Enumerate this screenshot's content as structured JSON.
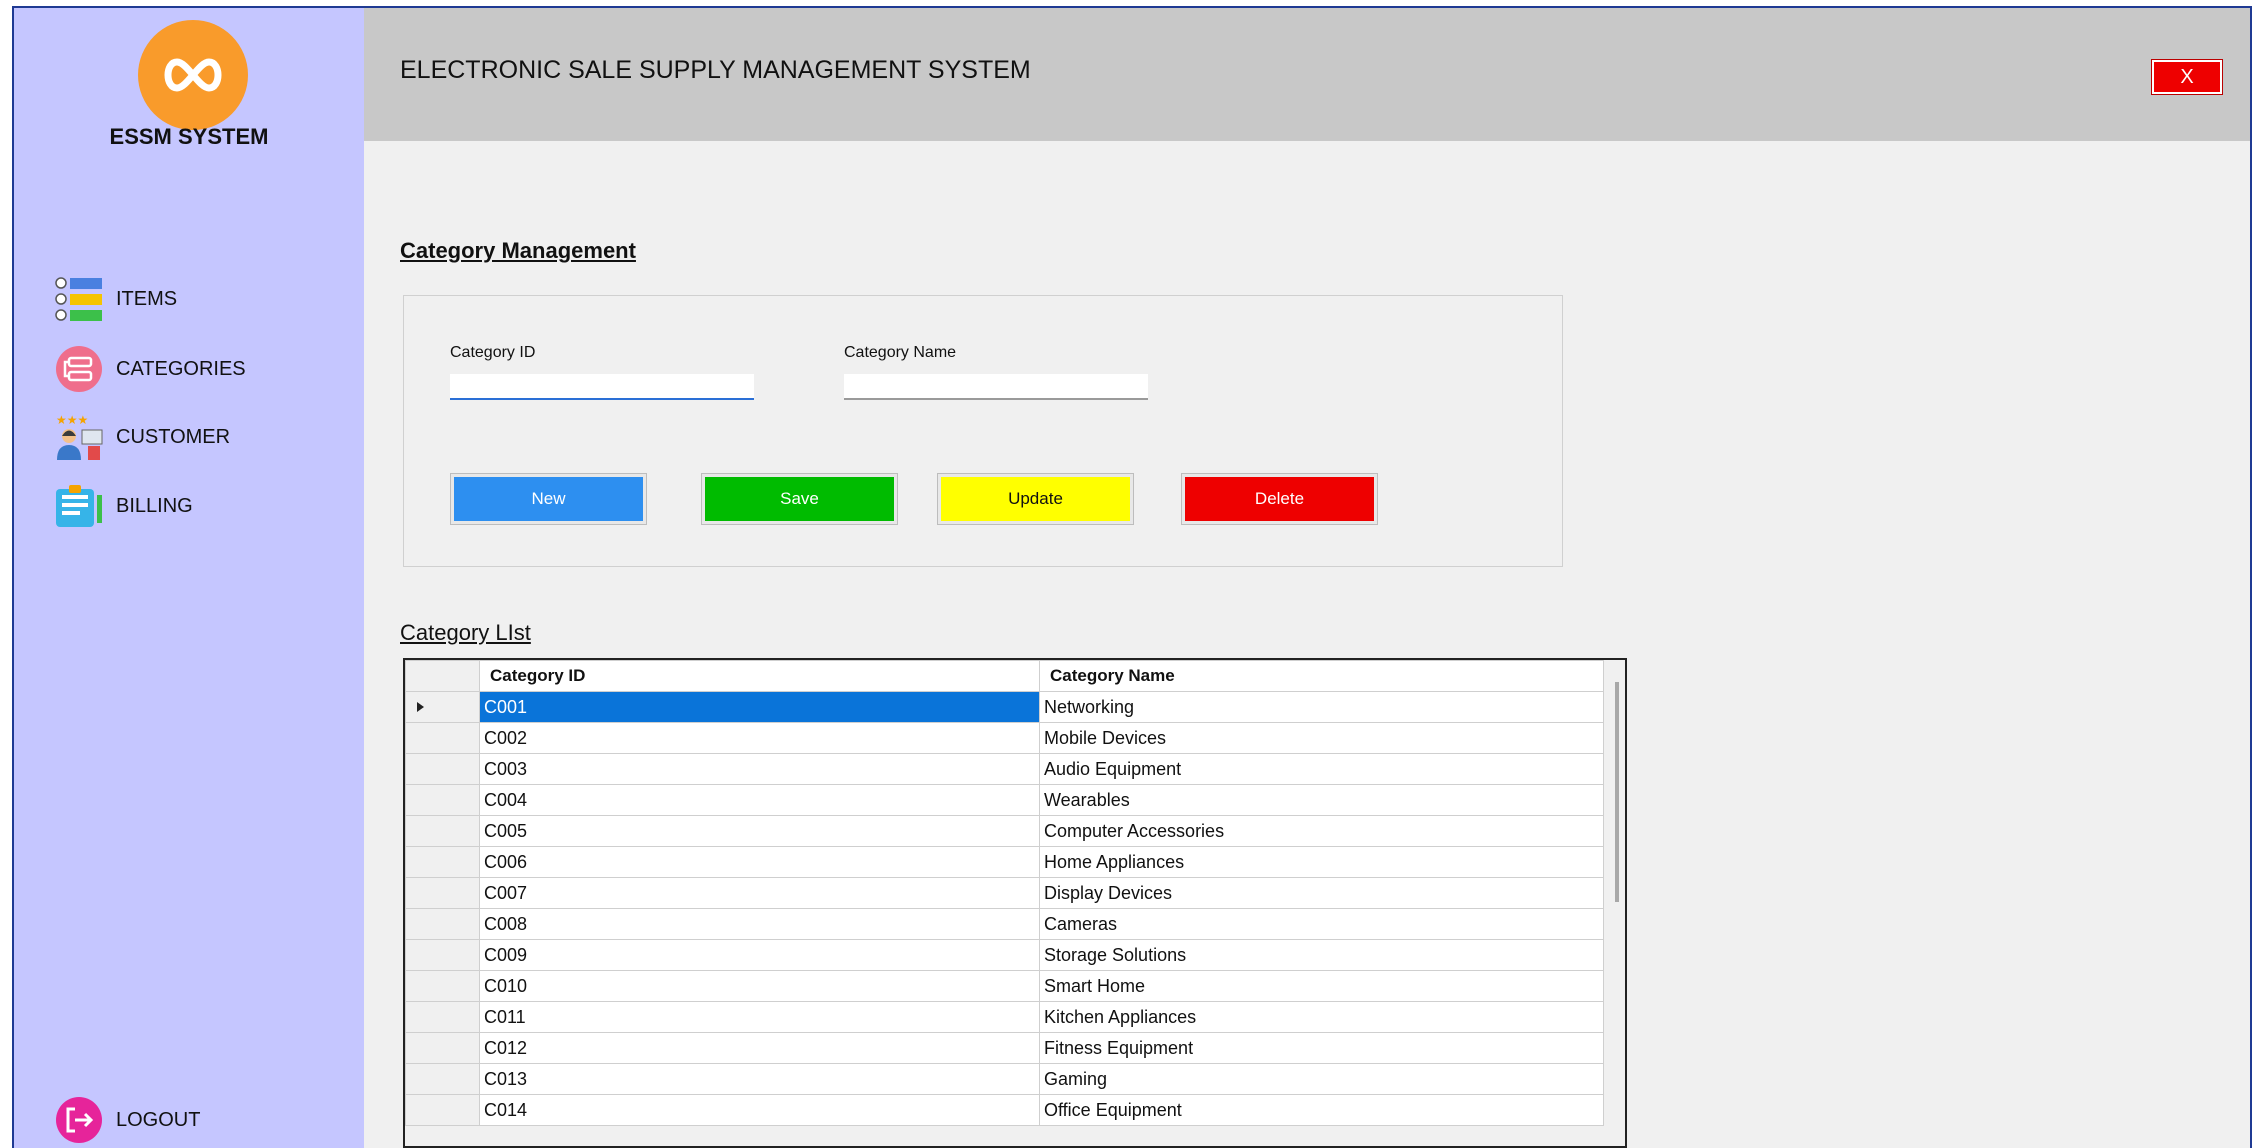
{
  "app": {
    "logo_text": "ESSM SYSTEM",
    "title": "ELECTRONIC SALE SUPPLY MANAGEMENT SYSTEM",
    "close_label": "X"
  },
  "sidebar": {
    "items": [
      {
        "label": "ITEMS",
        "icon": "items-list-icon"
      },
      {
        "label": "CATEGORIES",
        "icon": "categories-icon"
      },
      {
        "label": "CUSTOMER",
        "icon": "customer-icon"
      },
      {
        "label": "BILLING",
        "icon": "billing-icon"
      }
    ],
    "logout_label": "LOGOUT"
  },
  "form": {
    "section_title": "Category Management",
    "category_id_label": "Category ID",
    "category_id_value": "",
    "category_name_label": "Category Name",
    "category_name_value": "",
    "buttons": {
      "new": "New",
      "save": "Save",
      "update": "Update",
      "delete": "Delete"
    }
  },
  "list": {
    "title": "Category LIst",
    "columns": [
      "Category ID",
      "Category Name"
    ],
    "rows": [
      {
        "id": "C001",
        "name": "Networking",
        "selected": true
      },
      {
        "id": "C002",
        "name": "Mobile Devices"
      },
      {
        "id": "C003",
        "name": "Audio Equipment"
      },
      {
        "id": "C004",
        "name": "Wearables"
      },
      {
        "id": "C005",
        "name": "Computer Accessories"
      },
      {
        "id": "C006",
        "name": "Home Appliances"
      },
      {
        "id": "C007",
        "name": "Display Devices"
      },
      {
        "id": "C008",
        "name": "Cameras"
      },
      {
        "id": "C009",
        "name": "Storage Solutions"
      },
      {
        "id": "C010",
        "name": "Smart Home"
      },
      {
        "id": "C011",
        "name": "Kitchen Appliances"
      },
      {
        "id": "C012",
        "name": "Fitness Equipment"
      },
      {
        "id": "C013",
        "name": "Gaming"
      },
      {
        "id": "C014",
        "name": "Office Equipment"
      }
    ]
  },
  "colors": {
    "sidebar_bg": "#c5c6ff",
    "logo_orange": "#f99b2b",
    "new_button": "#2d8ff0",
    "save_button": "#00bb00",
    "update_button": "#ffff00",
    "delete_button": "#ee0000",
    "selected_row": "#0a74d9"
  }
}
